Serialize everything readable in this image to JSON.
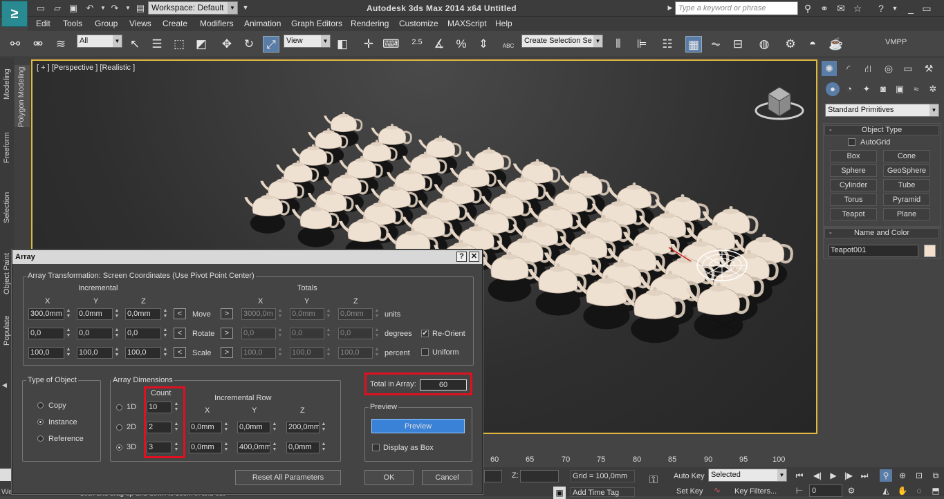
{
  "title_bar": {
    "app_title": "Autodesk 3ds Max  2014 x64      Untitled",
    "workspace": "Workspace: Default",
    "search_placeholder": "Type a keyword or phrase"
  },
  "menu": [
    "Edit",
    "Tools",
    "Group",
    "Views",
    "Create",
    "Modifiers",
    "Animation",
    "Graph Editors",
    "Rendering",
    "Customize",
    "MAXScript",
    "Help"
  ],
  "toolbar": {
    "filter_value": "All",
    "coord_value": "View",
    "snap_angle": "2.5",
    "selection_set": "Create Selection Se",
    "vmpp": "VMPP",
    "abc_label": "ABC"
  },
  "ribbon_tabs": [
    "Modeling",
    "Polygon Modeling",
    "Freeform",
    "Selection",
    "Object Paint",
    "Populate"
  ],
  "viewport": {
    "label": "[ + ] [Perspective ] [Realistic ]"
  },
  "command_panel": {
    "category": "Standard Primitives",
    "object_type_header": "Object Type",
    "autogrid": "AutoGrid",
    "buttons": [
      "Box",
      "Cone",
      "Sphere",
      "GeoSphere",
      "Cylinder",
      "Tube",
      "Torus",
      "Pyramid",
      "Teapot",
      "Plane"
    ],
    "name_color_header": "Name and Color",
    "object_name": "Teapot001",
    "object_color": "#f2e0cc"
  },
  "dialog": {
    "title": "Array",
    "help_btn": "?",
    "close_btn": "✕",
    "transform_group": "Array Transformation: Screen Coordinates (Use Pivot Point Center)",
    "incremental": "Incremental",
    "totals": "Totals",
    "axes": [
      "X",
      "Y",
      "Z"
    ],
    "rows": [
      {
        "label": "Move",
        "inc": [
          "300,0mm",
          "0,0mm",
          "0,0mm"
        ],
        "tot": [
          "3000,0m",
          "0,0mm",
          "0,0mm"
        ],
        "unit": "units"
      },
      {
        "label": "Rotate",
        "inc": [
          "0,0",
          "0,0",
          "0,0"
        ],
        "tot": [
          "0,0",
          "0,0",
          "0,0"
        ],
        "unit": "degrees"
      },
      {
        "label": "Scale",
        "inc": [
          "100,0",
          "100,0",
          "100,0"
        ],
        "tot": [
          "100,0",
          "100,0",
          "100,0"
        ],
        "unit": "percent"
      }
    ],
    "arrow_left": "<",
    "arrow_right": ">",
    "reorient": "Re-Orient",
    "uniform": "Uniform",
    "type_group": "Type of Object",
    "types": [
      "Copy",
      "Instance",
      "Reference"
    ],
    "dims_group": "Array Dimensions",
    "count_label": "Count",
    "incremental_row": "Incremental Row",
    "dims": [
      {
        "label": "1D",
        "count": "10",
        "row": []
      },
      {
        "label": "2D",
        "count": "2",
        "row": [
          "0,0mm",
          "0,0mm",
          "200,0mm"
        ]
      },
      {
        "label": "3D",
        "count": "3",
        "row": [
          "0,0mm",
          "400,0mm",
          "0,0mm"
        ]
      }
    ],
    "total_label": "Total in Array:",
    "total_value": "60",
    "preview_group": "Preview",
    "preview_btn": "Preview",
    "display_box": "Display as Box",
    "reset_btn": "Reset All Parameters",
    "ok_btn": "OK",
    "cancel_btn": "Cancel"
  },
  "timeline": {
    "ticks": [
      "60",
      "65",
      "70",
      "75",
      "80",
      "85",
      "90",
      "95",
      "100"
    ]
  },
  "status": {
    "z_label": "Z:",
    "grid": "Grid = 100,0mm",
    "auto_key": "Auto Key",
    "selected": "Selected",
    "set_key": "Set Key",
    "key_filters": "Key Filters...",
    "add_time_tag": "Add Time Tag",
    "frame": "0",
    "prompt": "Click and drag up-and-down to zoom in and out",
    "script_prefix": "We"
  },
  "colors": {
    "viewport_border": "#e0b840",
    "highlight": "#e01020",
    "preview_blue": "#3a82d8"
  }
}
